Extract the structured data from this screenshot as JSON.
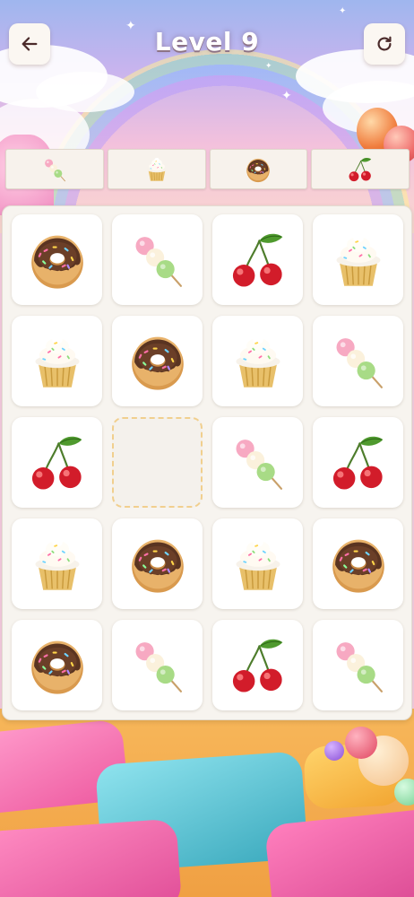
{
  "header": {
    "title": "Level 9",
    "back_icon": "back-arrow-icon",
    "restart_icon": "restart-icon"
  },
  "targets": [
    {
      "item": "dango"
    },
    {
      "item": "cupcake"
    },
    {
      "item": "donut"
    },
    {
      "item": "cherry"
    }
  ],
  "board": {
    "rows": 5,
    "cols": 4,
    "cells": [
      [
        "donut",
        "dango",
        "cherry",
        "cupcake"
      ],
      [
        "cupcake",
        "donut",
        "cupcake",
        "dango"
      ],
      [
        "cherry",
        "empty",
        "dango",
        "cherry"
      ],
      [
        "cupcake",
        "donut",
        "cupcake",
        "donut"
      ],
      [
        "donut",
        "dango",
        "cherry",
        "dango"
      ]
    ]
  },
  "colors": {
    "accent_text": "#ffffff",
    "tile_bg": "#ffffff",
    "board_bg": "#f7f4ef",
    "empty_border": "#f1cf8e"
  }
}
